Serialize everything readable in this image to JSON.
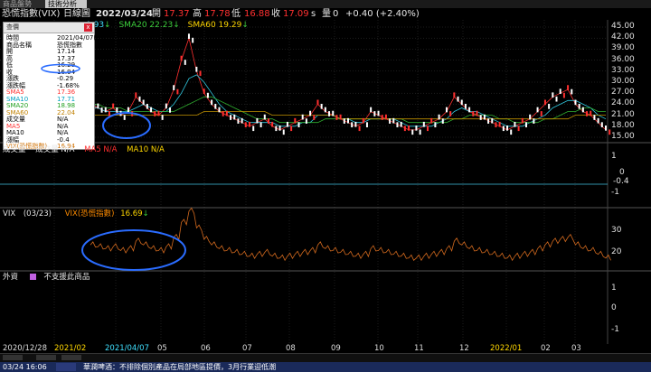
{
  "tabs": [
    "商品盤勢",
    "技術分析"
  ],
  "header": {
    "symbol": "恐慌指數(VIX)",
    "period": "日線圖",
    "date": "2022/03/24",
    "open_label": "開",
    "open": "17.37",
    "high_label": "高",
    "high": "17.78",
    "low_label": "低",
    "low": "16.88",
    "close_label": "收",
    "close": "17.09",
    "unit": "s",
    "volume_label": "量",
    "volume": "0",
    "change": "+0.40 (+2.40%)"
  },
  "ma_row": {
    "partial": "0.93",
    "sma20": "SMA20 22.23",
    "sma60": "SMA60 19.29"
  },
  "price_axis": [
    "45.00",
    "42.00",
    "39.00",
    "36.00",
    "33.00",
    "30.00",
    "27.00",
    "24.00",
    "21.00",
    "18.00",
    "15.00"
  ],
  "popup": {
    "title": "查價",
    "close_btn": "x",
    "rows": [
      {
        "k": "時間",
        "v": "2021/04/07(三)",
        "kc": "#000",
        "vc": "#000"
      },
      {
        "k": "商品名稱",
        "v": "恐慌指數",
        "kc": "#000",
        "vc": "#000"
      },
      {
        "k": "開",
        "v": "17.14",
        "kc": "#000",
        "vc": "#000"
      },
      {
        "k": "高",
        "v": "17.37",
        "kc": "#000",
        "vc": "#000"
      },
      {
        "k": "低",
        "v": "16.29",
        "kc": "#000",
        "vc": "#000"
      },
      {
        "k": "收",
        "v": "16.94",
        "kc": "#000",
        "vc": "#000"
      },
      {
        "k": "漲跌",
        "v": "-0.29",
        "kc": "#000",
        "vc": "#000"
      },
      {
        "k": "漲跌幅",
        "v": "-1.68%",
        "kc": "#000",
        "vc": "#000"
      },
      {
        "k": "SMA5",
        "v": "17.36",
        "kc": "#ff3030",
        "vc": "#ff3030"
      },
      {
        "k": "SMA10",
        "v": "17.71",
        "kc": "#00a0c0",
        "vc": "#00a0c0"
      },
      {
        "k": "SMA20",
        "v": "18.98",
        "kc": "#20a020",
        "vc": "#20a020"
      },
      {
        "k": "SMA60",
        "v": "22.04",
        "kc": "#c08000",
        "vc": "#c08000"
      },
      {
        "k": "成交量",
        "v": "N/A",
        "kc": "#000",
        "vc": "#000"
      },
      {
        "k": "MA5",
        "v": "N/A",
        "kc": "#ff3030",
        "vc": "#000"
      },
      {
        "k": "MA10",
        "v": "N/A",
        "kc": "#000",
        "vc": "#000"
      },
      {
        "k": "漲幅",
        "v": "-0.4",
        "kc": "#000",
        "vc": "#000"
      },
      {
        "k": "VIX(恐慌指數)",
        "v": "16.94",
        "kc": "#d07000",
        "vc": "#d07000"
      }
    ]
  },
  "volume_panel": {
    "label": "成交量",
    "vol": "成交量 N/A",
    "ma5": "MA5 N/A",
    "ma10": "MA10 N/A",
    "axis": [
      "1",
      "0",
      "-0.4",
      "-1"
    ]
  },
  "vix_panel": {
    "label": "VIX",
    "date": "(03/23)",
    "name": "VIX(恐慌指數)",
    "value": "16.69",
    "axis": [
      "30",
      "20"
    ]
  },
  "foreign_panel": {
    "label": "外資",
    "note": "不支援此商品",
    "axis": [
      "1",
      "0",
      "-1"
    ]
  },
  "date_axis": [
    {
      "t": "2020/12/28",
      "c": "#ddd"
    },
    {
      "t": "2021/02",
      "c": "#ffd700"
    },
    {
      "t": "2021/04/07",
      "c": "#40e0ff"
    },
    {
      "t": "05",
      "c": "#ddd"
    },
    {
      "t": "06",
      "c": "#ddd"
    },
    {
      "t": "07",
      "c": "#ddd"
    },
    {
      "t": "08",
      "c": "#ddd"
    },
    {
      "t": "09",
      "c": "#ddd"
    },
    {
      "t": "10",
      "c": "#ddd"
    },
    {
      "t": "11",
      "c": "#ddd"
    },
    {
      "t": "12",
      "c": "#ddd"
    },
    {
      "t": "2022/01",
      "c": "#ffd700"
    },
    {
      "t": "02",
      "c": "#ddd"
    },
    {
      "t": "03",
      "c": "#ddd"
    }
  ],
  "status": {
    "time": "03/24 16:06",
    "ticker": "華潤啤酒：不排除個別產品在局部地區提價，3月行業迎低潮"
  },
  "chart_data": {
    "type": "line",
    "series": [
      {
        "values": [
          24,
          23,
          22,
          23,
          21,
          22,
          26,
          24,
          22,
          21,
          23,
          28,
          36,
          42,
          33,
          27,
          24,
          22,
          21,
          20,
          19,
          18,
          19,
          20,
          18,
          17,
          18,
          19,
          20,
          21,
          24,
          22,
          21,
          20,
          19,
          18,
          19,
          22,
          21,
          20,
          19,
          18,
          17,
          17,
          18,
          19,
          20,
          22,
          26,
          24,
          22,
          21,
          20,
          19,
          18,
          17,
          18,
          19,
          20,
          22,
          24,
          26,
          27,
          28,
          24,
          22,
          21,
          19,
          17
        ]
      },
      {
        "values": [
          23,
          23,
          22,
          22,
          22,
          22,
          23,
          24,
          23,
          22,
          22,
          24,
          27,
          31,
          32,
          30,
          27,
          24,
          22,
          21,
          20,
          19,
          19,
          19,
          19,
          18,
          18,
          18,
          19,
          19,
          21,
          21,
          21,
          20,
          20,
          19,
          19,
          20,
          20,
          20,
          20,
          19,
          18,
          18,
          18,
          18,
          19,
          20,
          22,
          23,
          22,
          22,
          21,
          20,
          19,
          18,
          18,
          18,
          19,
          20,
          21,
          23,
          24,
          25,
          25,
          24,
          23,
          21,
          20
        ]
      },
      {
        "values": [
          24,
          24,
          23,
          23,
          23,
          22,
          22,
          22,
          22,
          22,
          22,
          22,
          23,
          24,
          25,
          26,
          26,
          25,
          24,
          23,
          22,
          21,
          20,
          20,
          20,
          19,
          19,
          19,
          19,
          19,
          19,
          20,
          20,
          20,
          20,
          20,
          20,
          20,
          20,
          20,
          20,
          20,
          19,
          19,
          19,
          19,
          19,
          19,
          20,
          20,
          21,
          21,
          21,
          21,
          20,
          20,
          19,
          19,
          19,
          19,
          20,
          20,
          21,
          22,
          22,
          23,
          23,
          22,
          22
        ]
      },
      {
        "values": [
          21,
          21,
          21,
          21,
          21,
          21,
          21,
          21,
          21,
          21,
          21,
          21,
          21,
          21,
          21,
          22,
          22,
          22,
          22,
          22,
          22,
          22,
          22,
          22,
          21,
          21,
          21,
          21,
          21,
          21,
          21,
          21,
          21,
          20,
          20,
          20,
          20,
          20,
          20,
          20,
          20,
          20,
          20,
          20,
          20,
          20,
          20,
          20,
          20,
          20,
          20,
          20,
          20,
          20,
          20,
          20,
          20,
          20,
          20,
          20,
          20,
          20,
          20,
          20,
          21,
          21,
          21,
          21,
          21
        ]
      }
    ],
    "ylim": [
      15,
      45
    ]
  }
}
